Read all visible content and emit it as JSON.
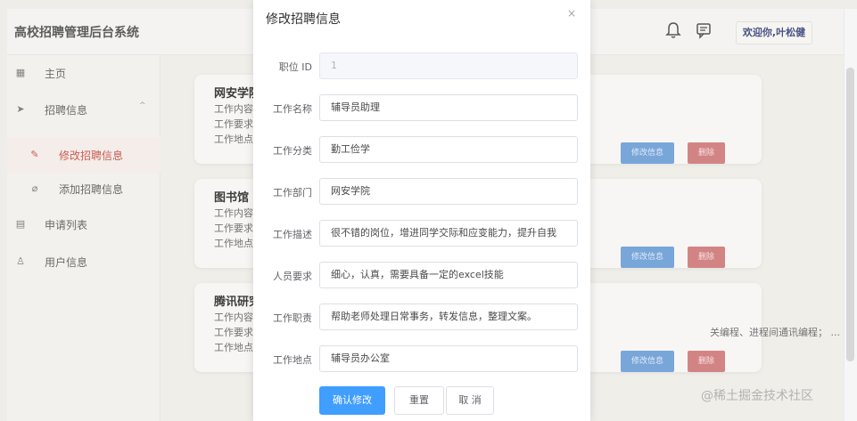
{
  "app": {
    "title": "高校招聘管理后台系统",
    "welcome": "欢迎你,叶松健",
    "icons": {
      "bell": "bell-icon",
      "message": "message-icon"
    }
  },
  "sidebar": {
    "items": [
      {
        "label": "主页",
        "icon": "grid-icon"
      },
      {
        "label": "招聘信息",
        "icon": "send-icon",
        "caret": "^"
      },
      {
        "label": "修改招聘信息",
        "icon": "edit-icon"
      },
      {
        "label": "添加招聘信息",
        "icon": "paperclip-icon"
      },
      {
        "label": "申请列表",
        "icon": "document-icon"
      },
      {
        "label": "用户信息",
        "icon": "user-icon"
      }
    ]
  },
  "cards": [
    {
      "title": "网安学院",
      "lines": [
        "工作内容",
        "工作要求",
        "工作地点"
      ],
      "extra": "",
      "edit_label": "修改信息",
      "delete_label": "删除"
    },
    {
      "title": "图书馆",
      "lines": [
        "工作内容",
        "工作要求",
        "工作地点"
      ],
      "extra": "",
      "edit_label": "修改信息",
      "delete_label": "删除"
    },
    {
      "title": "腾讯研究",
      "lines": [
        "工作内容",
        "工作要求",
        "工作地点"
      ],
      "extra": "关编程、进程间通讯编程； ...",
      "edit_label": "修改信息",
      "delete_label": "删除"
    }
  ],
  "watermark": "@稀土掘金技术社区",
  "dialog": {
    "title": "修改招聘信息",
    "close": "×",
    "fields": [
      {
        "label": "职位 ID",
        "value": "1"
      },
      {
        "label": "工作名称",
        "value": "辅导员助理"
      },
      {
        "label": "工作分类",
        "value": "勤工俭学"
      },
      {
        "label": "工作部门",
        "value": "网安学院"
      },
      {
        "label": "工作描述",
        "value": "很不错的岗位，增进同学交际和应变能力，提升自我"
      },
      {
        "label": "人员要求",
        "value": "细心，认真，需要具备一定的excel技能"
      },
      {
        "label": "工作职责",
        "value": "帮助老师处理日常事务，转发信息，整理文案。"
      },
      {
        "label": "工作地点",
        "value": "辅导员办公室"
      }
    ],
    "buttons": {
      "confirm": "确认修改",
      "reset": "重置",
      "cancel": "取 消"
    }
  },
  "colors": {
    "primary": "#409eff",
    "danger": "#c96a6a",
    "active": "#c0392b"
  }
}
